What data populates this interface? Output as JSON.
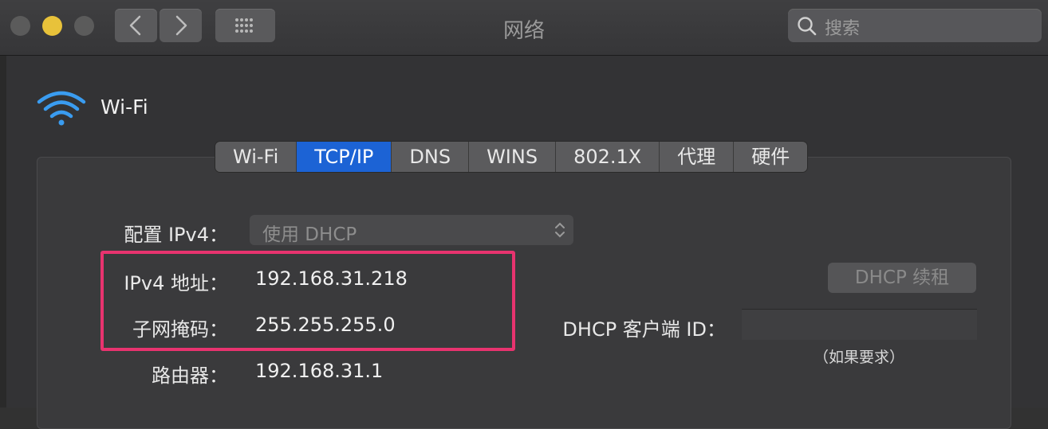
{
  "window": {
    "title": "网络",
    "traffic_lights": {
      "close": "#5b5b5b",
      "minimize": "#e8c23a",
      "zoom": "#5b5b5b"
    }
  },
  "toolbar": {
    "back_icon": "chevron-left-icon",
    "forward_icon": "chevron-right-icon",
    "grid_icon": "grid-icon",
    "search_placeholder": "搜索"
  },
  "interface": {
    "name": "Wi-Fi",
    "icon": "wifi-icon",
    "icon_color": "#3a9cf0"
  },
  "tabs": [
    {
      "label": "Wi-Fi",
      "active": false
    },
    {
      "label": "TCP/IP",
      "active": true
    },
    {
      "label": "DNS",
      "active": false
    },
    {
      "label": "WINS",
      "active": false
    },
    {
      "label": "802.1X",
      "active": false
    },
    {
      "label": "代理",
      "active": false
    },
    {
      "label": "硬件",
      "active": false
    }
  ],
  "tcpip": {
    "configure_label": "配置 IPv4：",
    "configure_value": "使用 DHCP",
    "ipv4_label": "IPv4 地址：",
    "ipv4_value": "192.168.31.218",
    "subnet_label": "子网掩码：",
    "subnet_value": "255.255.255.0",
    "router_label": "路由器：",
    "router_value": "192.168.31.1",
    "renew_button": "DHCP 续租",
    "client_id_label": "DHCP 客户端 ID：",
    "client_id_value": "",
    "client_id_hint": "（如果要求）"
  },
  "colors": {
    "accent": "#1c63d5",
    "highlight": "#e8336f"
  }
}
